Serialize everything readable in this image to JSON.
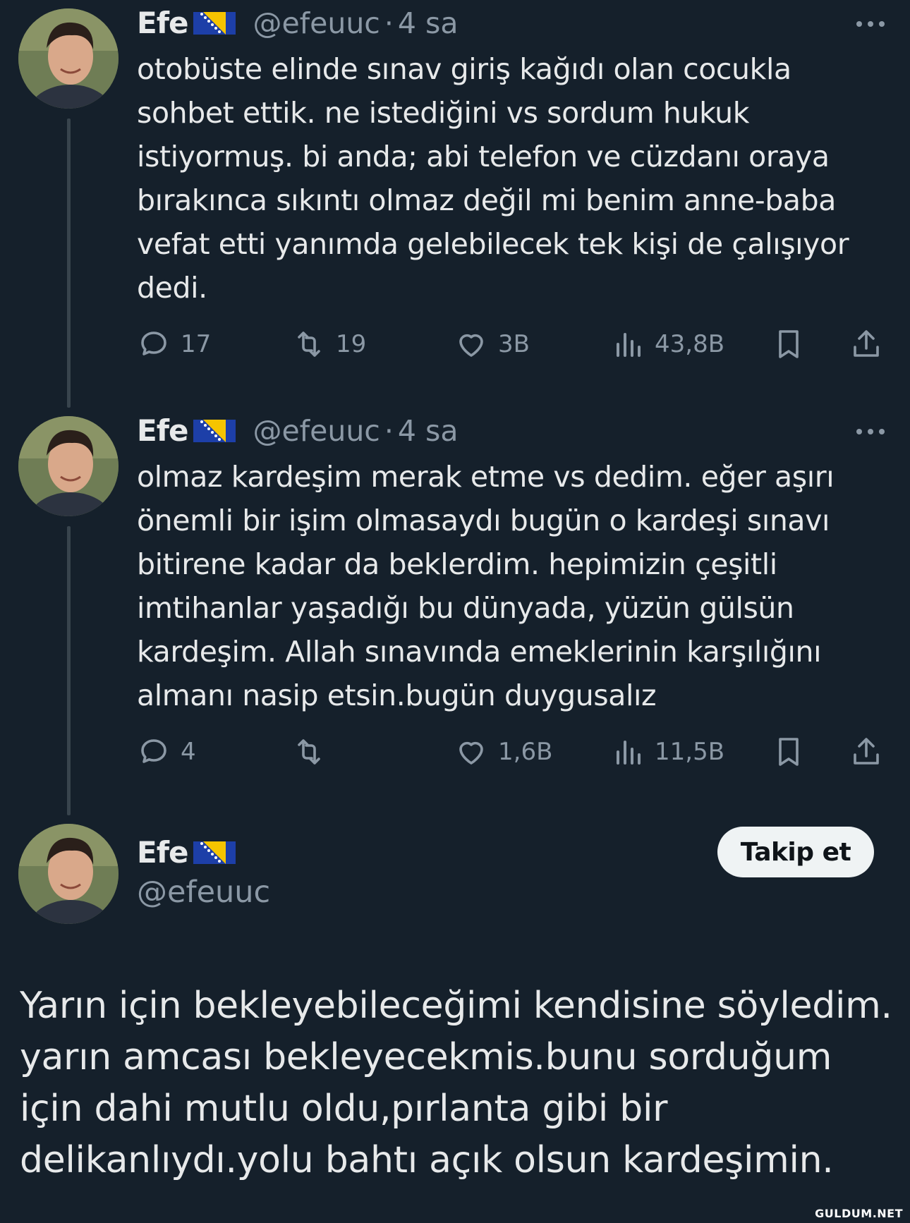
{
  "tweets": [
    {
      "name": "Efe",
      "handle": "@efeuuc",
      "separator": "·",
      "time": "4 sa",
      "text": "otobüste elinde sınav giriş kağıdı olan cocukla sohbet ettik. ne istediğini vs sordum hukuk istiyormuş. bi anda; abi telefon ve cüzdanı oraya bırakınca sıkıntı olmaz değil mi benim anne-baba vefat etti yanımda gelebilecek tek kişi de çalışıyor dedi.",
      "replies": "17",
      "retweets": "19",
      "likes": "3B",
      "views": "43,8B"
    },
    {
      "name": "Efe",
      "handle": "@efeuuc",
      "separator": "·",
      "time": "4 sa",
      "text": "olmaz kardeşim merak etme vs dedim. eğer aşırı önemli bir işim olmasaydı bugün o kardeşi sınavı bitirene kadar da beklerdim. hepimizin çeşitli imtihanlar yaşadığı bu dünyada, yüzün gülsün kardeşim. Allah sınavında emeklerinin karşılığını almanı nasip etsin.bugün duygusalız",
      "replies": "4",
      "retweets": "",
      "likes": "1,6B",
      "views": "11,5B"
    }
  ],
  "final_tweet": {
    "name": "Efe",
    "handle": "@efeuuc",
    "follow_label": "Takip et",
    "text": "Yarın için bekleyebileceğimi kendisine söyledim. yarın amcası bekleyecekmis.bunu sorduğum için dahi mutlu oldu,pırlanta gibi bir delikanlıydı.yolu bahtı açık olsun kardeşimin."
  },
  "watermark": "GULDUM.NET",
  "icons": {
    "reply": "reply-icon",
    "retweet": "retweet-icon",
    "like": "heart-icon",
    "views": "views-icon",
    "bookmark": "bookmark-icon",
    "share": "share-icon",
    "more": "more-icon",
    "flag": "bosnia-flag-icon"
  },
  "colors": {
    "background": "#15202b",
    "text": "#e7e9ea",
    "secondary": "#8b98a5",
    "button": "#eff3f4"
  }
}
